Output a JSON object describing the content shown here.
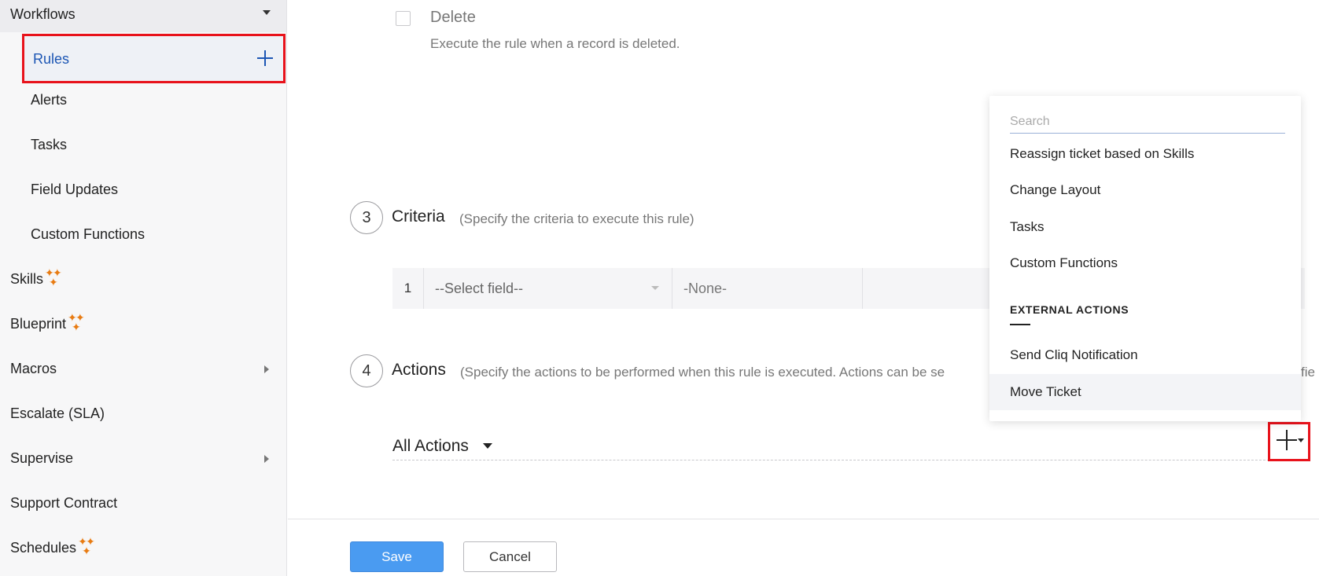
{
  "sidebar": {
    "section_title": "Workflows",
    "rules_label": "Rules",
    "items": [
      "Alerts",
      "Tasks",
      "Field Updates",
      "Custom Functions"
    ],
    "top_items": {
      "skills": "Skills",
      "blueprint": "Blueprint",
      "macros": "Macros",
      "escalate": "Escalate (SLA)",
      "supervise": "Supervise",
      "support_contract": "Support Contract",
      "schedules": "Schedules"
    },
    "sparkle_glyph": "✦",
    "accent_color": "#1c56b4",
    "highlight_color": "#e8121b",
    "sparkle_color": "#e87b12"
  },
  "main": {
    "delete_option": {
      "title": "Delete",
      "description": "Execute the rule when a record is deleted."
    },
    "criteria": {
      "step": "3",
      "title": "Criteria",
      "hint": "(Specify the criteria to execute this rule)",
      "row": {
        "number": "1",
        "field_placeholder": "--Select field--",
        "operator": "-None-"
      }
    },
    "actions": {
      "step": "4",
      "title": "Actions",
      "hint": "(Specify the actions to be performed when this rule is executed. Actions can be se",
      "hint_tail": "fie",
      "all_actions_label": "All Actions"
    }
  },
  "dropdown": {
    "search_placeholder": "Search",
    "items": [
      "Reassign ticket based on Skills",
      "Change Layout",
      "Tasks",
      "Custom Functions"
    ],
    "external_section": "EXTERNAL ACTIONS",
    "external_items": [
      "Send Cliq Notification",
      "Move Ticket"
    ]
  },
  "footer": {
    "save_label": "Save",
    "cancel_label": "Cancel",
    "save_color": "#4a9bf1"
  }
}
